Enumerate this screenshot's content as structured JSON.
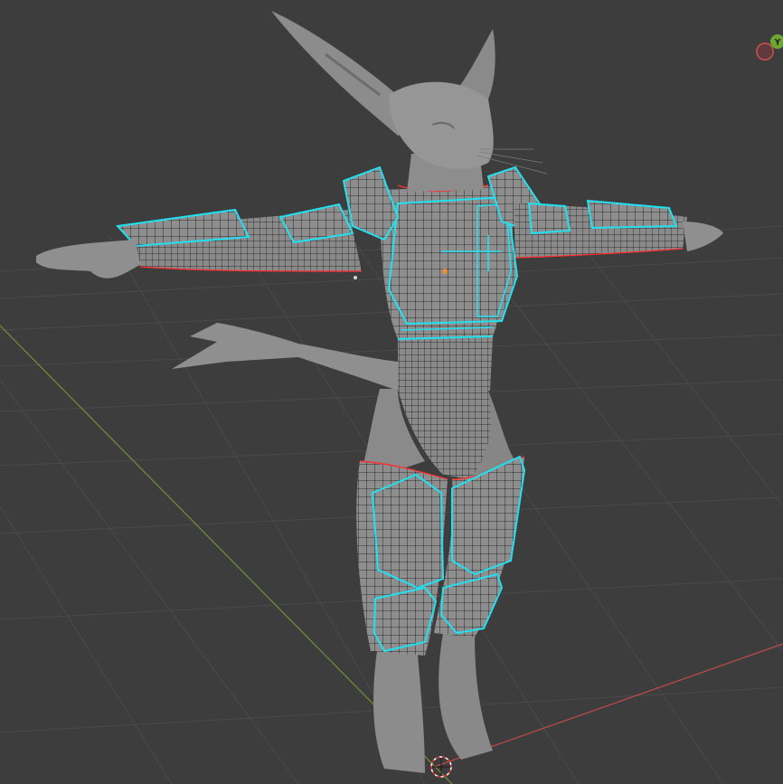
{
  "viewport": {
    "background_color": "#3d3d3d",
    "grid_color": "#4a4a4a",
    "x_axis_color": "#b84a4a",
    "y_axis_color": "#6c8a3a",
    "mesh_color": "#909090",
    "wire_color": "#111111",
    "selected_edge_color": "#22e0f0",
    "seam_color": "#ff3030"
  },
  "gizmo": {
    "y_label": "Y",
    "y_color": "#6ca830",
    "x_color": "#c04848"
  },
  "object": {
    "name_icon": "origin-dot-icon"
  }
}
